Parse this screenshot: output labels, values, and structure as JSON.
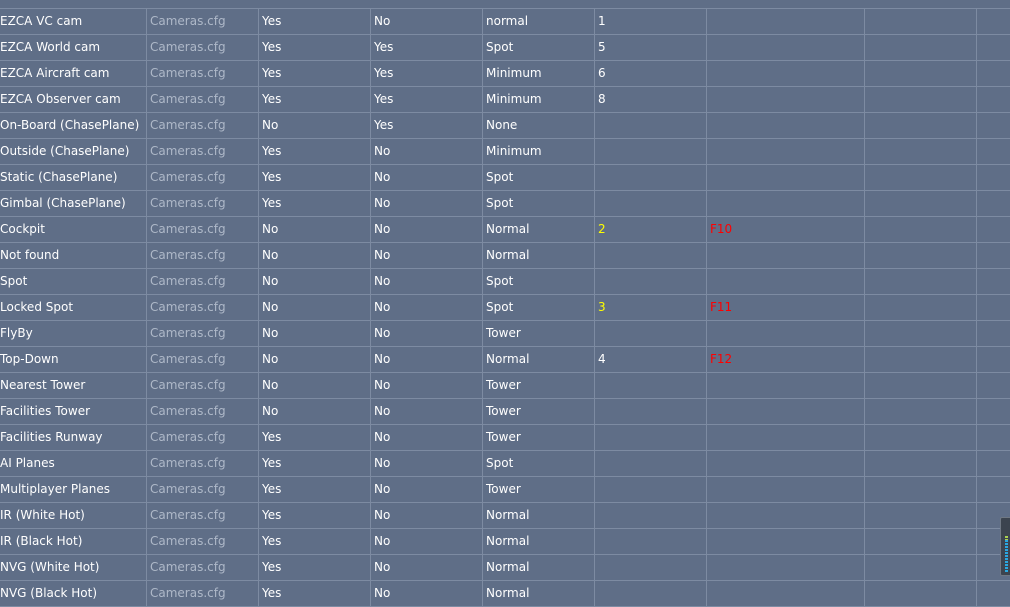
{
  "colors": {
    "background": "#5f6e87",
    "gridline": "#7d8ba2",
    "file_text": "#aeb8c8",
    "highlight_number": "#ffff00",
    "hotkey": "#ff0000"
  },
  "rows": [
    {
      "name": "EZCA VC cam",
      "file": "Cameras.cfg",
      "c2": "Yes",
      "c3": "No",
      "mode": "normal",
      "num": "1",
      "num_highlight": false,
      "key": ""
    },
    {
      "name": "EZCA World cam",
      "file": "Cameras.cfg",
      "c2": "Yes",
      "c3": "Yes",
      "mode": "Spot",
      "num": "5",
      "num_highlight": false,
      "key": ""
    },
    {
      "name": "EZCA Aircraft cam",
      "file": "Cameras.cfg",
      "c2": "Yes",
      "c3": "Yes",
      "mode": "Minimum",
      "num": "6",
      "num_highlight": false,
      "key": ""
    },
    {
      "name": "EZCA Observer cam",
      "file": "Cameras.cfg",
      "c2": "Yes",
      "c3": "Yes",
      "mode": "Minimum",
      "num": "8",
      "num_highlight": false,
      "key": ""
    },
    {
      "name": "On-Board (ChasePlane)",
      "file": "Cameras.cfg",
      "c2": "No",
      "c3": "Yes",
      "mode": "None",
      "num": "",
      "num_highlight": false,
      "key": ""
    },
    {
      "name": "Outside (ChasePlane)",
      "file": "Cameras.cfg",
      "c2": "Yes",
      "c3": "No",
      "mode": "Minimum",
      "num": "",
      "num_highlight": false,
      "key": ""
    },
    {
      "name": "Static (ChasePlane)",
      "file": "Cameras.cfg",
      "c2": "Yes",
      "c3": "No",
      "mode": "Spot",
      "num": "",
      "num_highlight": false,
      "key": ""
    },
    {
      "name": "Gimbal (ChasePlane)",
      "file": "Cameras.cfg",
      "c2": "Yes",
      "c3": "No",
      "mode": "Spot",
      "num": "",
      "num_highlight": false,
      "key": ""
    },
    {
      "name": "Cockpit",
      "file": "Cameras.cfg",
      "c2": "No",
      "c3": "No",
      "mode": "Normal",
      "num": "2",
      "num_highlight": true,
      "key": "F10"
    },
    {
      "name": "Not found",
      "file": "Cameras.cfg",
      "c2": "No",
      "c3": "No",
      "mode": "Normal",
      "num": "",
      "num_highlight": false,
      "key": ""
    },
    {
      "name": "Spot",
      "file": "Cameras.cfg",
      "c2": "No",
      "c3": "No",
      "mode": "Spot",
      "num": "",
      "num_highlight": false,
      "key": ""
    },
    {
      "name": "Locked Spot",
      "file": "Cameras.cfg",
      "c2": "No",
      "c3": "No",
      "mode": "Spot",
      "num": "3",
      "num_highlight": true,
      "key": "F11"
    },
    {
      "name": "FlyBy",
      "file": "Cameras.cfg",
      "c2": "No",
      "c3": "No",
      "mode": "Tower",
      "num": "",
      "num_highlight": false,
      "key": ""
    },
    {
      "name": "Top-Down",
      "file": "Cameras.cfg",
      "c2": "No",
      "c3": "No",
      "mode": "Normal",
      "num": "4",
      "num_highlight": false,
      "key": "F12"
    },
    {
      "name": "Nearest Tower",
      "file": "Cameras.cfg",
      "c2": "No",
      "c3": "No",
      "mode": "Tower",
      "num": "",
      "num_highlight": false,
      "key": ""
    },
    {
      "name": "Facilities Tower",
      "file": "Cameras.cfg",
      "c2": "No",
      "c3": "No",
      "mode": "Tower",
      "num": "",
      "num_highlight": false,
      "key": ""
    },
    {
      "name": "Facilities Runway",
      "file": "Cameras.cfg",
      "c2": "Yes",
      "c3": "No",
      "mode": "Tower",
      "num": "",
      "num_highlight": false,
      "key": ""
    },
    {
      "name": "AI Planes",
      "file": "Cameras.cfg",
      "c2": "Yes",
      "c3": "No",
      "mode": "Spot",
      "num": "",
      "num_highlight": false,
      "key": ""
    },
    {
      "name": "Multiplayer Planes",
      "file": "Cameras.cfg",
      "c2": "Yes",
      "c3": "No",
      "mode": "Tower",
      "num": "",
      "num_highlight": false,
      "key": ""
    },
    {
      "name": "IR (White Hot)",
      "file": "Cameras.cfg",
      "c2": "Yes",
      "c3": "No",
      "mode": "Normal",
      "num": "",
      "num_highlight": false,
      "key": ""
    },
    {
      "name": "IR (Black Hot)",
      "file": "Cameras.cfg",
      "c2": "Yes",
      "c3": "No",
      "mode": "Normal",
      "num": "",
      "num_highlight": false,
      "key": ""
    },
    {
      "name": "NVG (White Hot)",
      "file": "Cameras.cfg",
      "c2": "Yes",
      "c3": "No",
      "mode": "Normal",
      "num": "",
      "num_highlight": false,
      "key": ""
    },
    {
      "name": "NVG (Black Hot)",
      "file": "Cameras.cfg",
      "c2": "Yes",
      "c3": "No",
      "mode": "Normal",
      "num": "",
      "num_highlight": false,
      "key": ""
    }
  ]
}
